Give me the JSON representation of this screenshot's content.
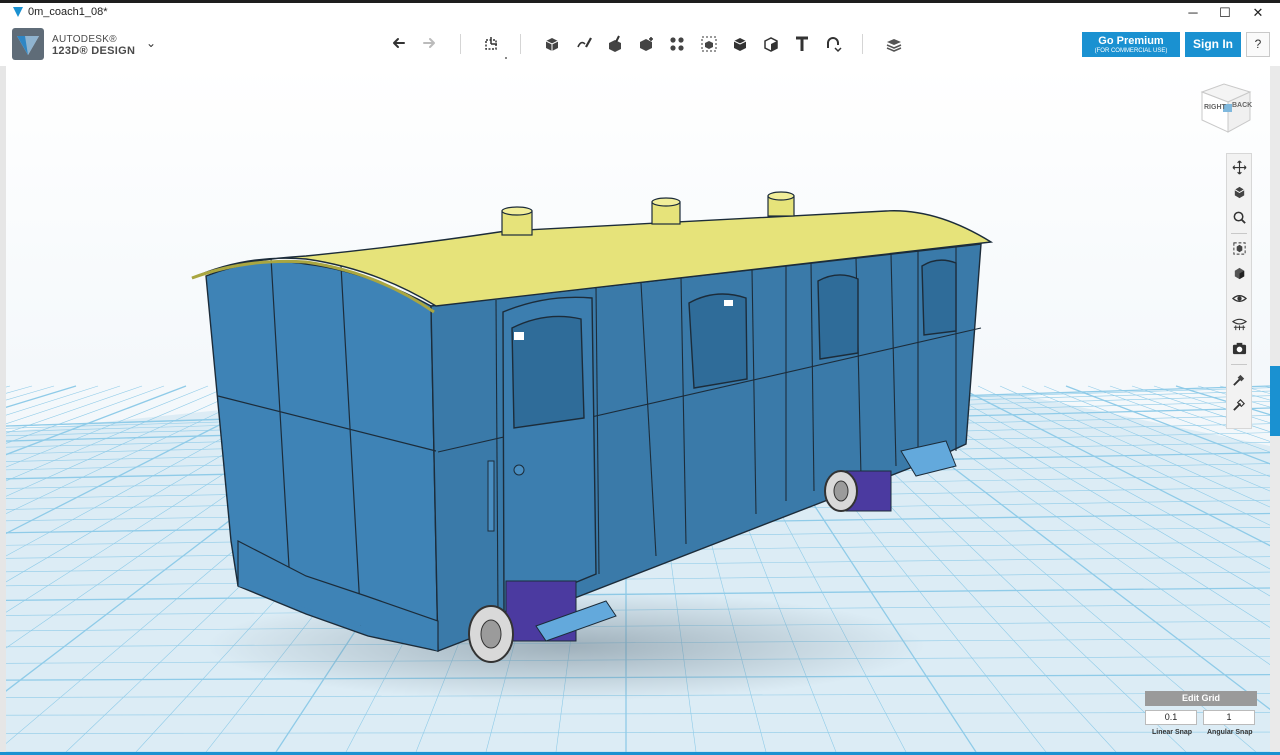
{
  "window": {
    "title": "0m_coach1_08*",
    "minimize": "─",
    "maximize": "☐",
    "close": "✕"
  },
  "brand": {
    "line1": "AUTODESK®",
    "line2": "123D® DESIGN",
    "dropdown": "⌄"
  },
  "toolbar": {
    "tools": [
      {
        "name": "undo-icon"
      },
      {
        "name": "redo-icon"
      },
      {
        "name": "transform-icon"
      },
      {
        "name": "primitives-icon"
      },
      {
        "name": "sketch-icon"
      },
      {
        "name": "construct-icon"
      },
      {
        "name": "modify-icon"
      },
      {
        "name": "pattern-icon"
      },
      {
        "name": "grouping-icon"
      },
      {
        "name": "combine-icon"
      },
      {
        "name": "measure-icon"
      },
      {
        "name": "text-icon"
      },
      {
        "name": "snap-icon"
      },
      {
        "name": "material-icon"
      }
    ],
    "premium_label": "Go Premium",
    "premium_sub": "(FOR COMMERCIAL USE)",
    "signin_label": "Sign In",
    "help_label": "?"
  },
  "viewcube": {
    "left": "RIGHT",
    "right": "BACK"
  },
  "navbar": {
    "items": [
      "pan-icon",
      "orbit-icon",
      "zoom-icon",
      "fit-icon",
      "view-icon",
      "visibility-icon",
      "grid-visibility-icon",
      "screenshot-icon",
      "materials-icon",
      "outline-icon"
    ]
  },
  "edit_grid": {
    "title": "Edit Grid",
    "linear_value": "0.1",
    "angular_value": "1",
    "linear_label": "Linear Snap",
    "angular_label": "Angular Snap"
  },
  "colors": {
    "accent": "#1a91d1",
    "body": "#3d7cab",
    "roof": "#e6e37a",
    "bogie": "#4b3aa0",
    "grid_line": "#8fcbe8",
    "grid_bg": "#dfeef6"
  }
}
